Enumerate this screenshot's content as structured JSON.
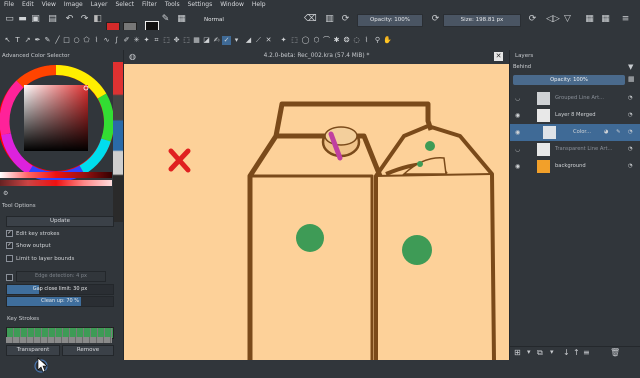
{
  "menu": [
    "File",
    "Edit",
    "View",
    "Image",
    "Layer",
    "Select",
    "Filter",
    "Tools",
    "Settings",
    "Window",
    "Help"
  ],
  "toolbar": {
    "blend_mode": "Normal",
    "opacity_label": "Opacity: 100%",
    "size_label": "Size:",
    "size_value": "198.81 px"
  },
  "color_selector": {
    "title": "Advanced Color Selector"
  },
  "tool_options": {
    "title": "Tool Options",
    "update_button": "Update",
    "edit_key_strokes": "Edit key strokes",
    "show_output": "Show output",
    "limit_to_layer_bounds": "Limit to layer bounds",
    "edge_detection": "Edge detection: 4 px",
    "gap_close_limit": "Gap close limit: 30 px",
    "clean_up": "Clean up: 70 %",
    "key_strokes_label": "Key Strokes",
    "transparent_button": "Transparent",
    "remove_button": "Remove",
    "clean_up_percent": 70
  },
  "document": {
    "title": "4.2.0-beta: Rec_002.kra (57.4 MiB) *"
  },
  "layers": {
    "title": "Layers",
    "blend_mode": "Behind",
    "opacity_label": "Opacity: 100%",
    "items": [
      {
        "name": "Grouped Line Art...",
        "selected": false
      },
      {
        "name": "Layer 8 Merged",
        "selected": false
      },
      {
        "name": "Color...",
        "selected": true
      },
      {
        "name": "Transparent Line Art...",
        "selected": false
      },
      {
        "name": "background",
        "selected": false
      }
    ]
  },
  "colors": {
    "accent": "#3f6a96",
    "canvas": "#fdd199",
    "line": "#7a4a1a",
    "green": "#3e9b56",
    "red_x": "#e02020",
    "cap_stripe": "#c040a0"
  }
}
